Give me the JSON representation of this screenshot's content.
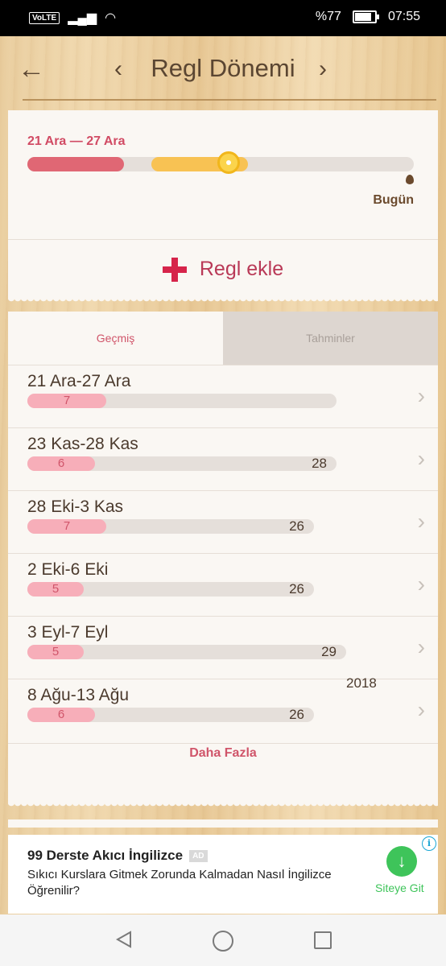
{
  "status": {
    "battery": "%77",
    "time": "07:55",
    "network": "VoLTE"
  },
  "header": {
    "title": "Regl Dönemi",
    "back_icon": "arrow-left-icon",
    "prev_icon": "chevron-left-icon",
    "next_icon": "chevron-right-icon"
  },
  "summary": {
    "range": "21 Ara — 27 Ara",
    "today_label": "Bugün",
    "add_label": "Regl ekle",
    "period_progress": 0.25,
    "fertile_start": 0.32,
    "fertile_end": 0.57,
    "ovulation_position": 0.52
  },
  "tabs": [
    {
      "label": "Geçmiş"
    },
    {
      "label": "Tahminler"
    }
  ],
  "history": [
    {
      "dates": "21 Ara-27 Ara",
      "period_days": "7",
      "cycle_days": ""
    },
    {
      "dates": "23 Kas-28 Kas",
      "period_days": "6",
      "cycle_days": "28"
    },
    {
      "dates": "28 Eki-3 Kas",
      "period_days": "7",
      "cycle_days": "26"
    },
    {
      "dates": "2 Eki-6 Eki",
      "period_days": "5",
      "cycle_days": "26"
    },
    {
      "dates": "3 Eyl-7 Eyl",
      "period_days": "5",
      "cycle_days": "29"
    },
    {
      "dates": "8 Ağu-13 Ağu",
      "period_days": "6",
      "cycle_days": "26"
    }
  ],
  "year_label": "2018",
  "more_label": "Daha Fazla",
  "ad": {
    "title": "99 Derste Akıcı İngilizce",
    "badge": "AD",
    "description": "Sıkıcı Kurslara Gitmek Zorunda Kalmadan Nasıl İngilizce Öğrenilir?",
    "cta": "Siteye Git"
  },
  "colors": {
    "accent": "#d0556a",
    "period": "#e06774",
    "fertile": "#f8c253",
    "cta": "#3ec45a"
  }
}
